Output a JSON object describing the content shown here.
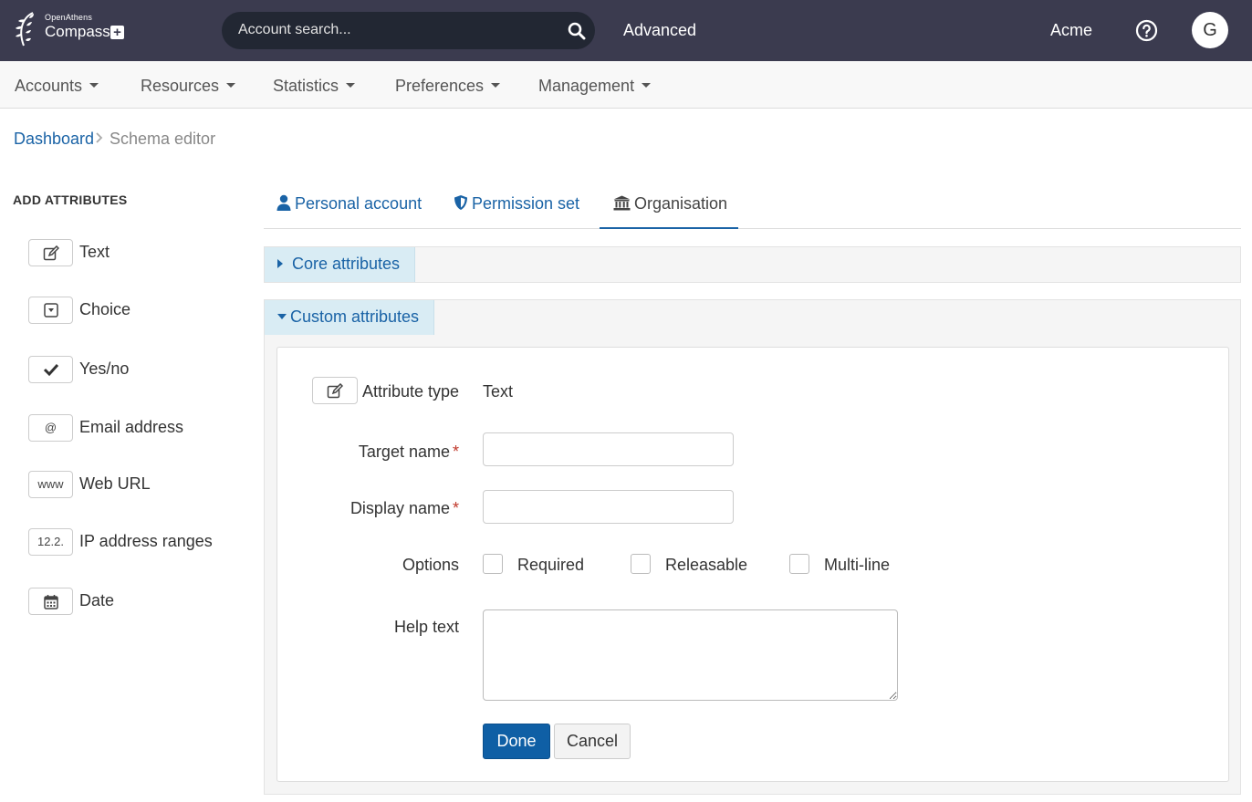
{
  "header": {
    "logo_top": "OpenAthens",
    "logo_main": "Compass",
    "logo_plus": "+",
    "search_placeholder": "Account search...",
    "advanced_label": "Advanced",
    "org_name": "Acme",
    "avatar_initial": "G"
  },
  "nav": {
    "items": [
      {
        "label": "Accounts"
      },
      {
        "label": "Resources"
      },
      {
        "label": "Statistics"
      },
      {
        "label": "Preferences"
      },
      {
        "label": "Management"
      }
    ]
  },
  "breadcrumb": {
    "parent": "Dashboard",
    "current": "Schema editor"
  },
  "sidebar": {
    "title": "ADD ATTRIBUTES",
    "items": [
      {
        "label": "Text",
        "icon": "edit-icon"
      },
      {
        "label": "Choice",
        "icon": "dropdown-icon"
      },
      {
        "label": "Yes/no",
        "icon": "check-icon"
      },
      {
        "label": "Email address",
        "icon_text": "@"
      },
      {
        "label": "Web URL",
        "icon_text": "www"
      },
      {
        "label": "IP address ranges",
        "icon_text": "12.2."
      },
      {
        "label": "Date",
        "icon": "calendar-icon"
      }
    ]
  },
  "tabs": [
    {
      "label": "Personal account",
      "icon": "user-icon"
    },
    {
      "label": "Permission set",
      "icon": "shield-icon"
    },
    {
      "label": "Organisation",
      "icon": "building-icon",
      "active": true
    }
  ],
  "panels": {
    "core_label": "Core attributes",
    "custom_label": "Custom attributes"
  },
  "form": {
    "attribute_type_label": "Attribute type",
    "attribute_type_value": "Text",
    "target_name_label": "Target name",
    "display_name_label": "Display name",
    "required_marker": "*",
    "target_name_value": "",
    "display_name_value": "",
    "options_label": "Options",
    "options": [
      {
        "label": "Required",
        "checked": false
      },
      {
        "label": "Releasable",
        "checked": false
      },
      {
        "label": "Multi-line",
        "checked": false
      }
    ],
    "help_text_label": "Help text",
    "help_text_value": "",
    "done_label": "Done",
    "cancel_label": "Cancel"
  },
  "colors": {
    "topbar": "#3b3b4f",
    "link": "#1a63a6",
    "primary_button": "#0f5fa5",
    "panel_header": "#d9ecf4"
  }
}
